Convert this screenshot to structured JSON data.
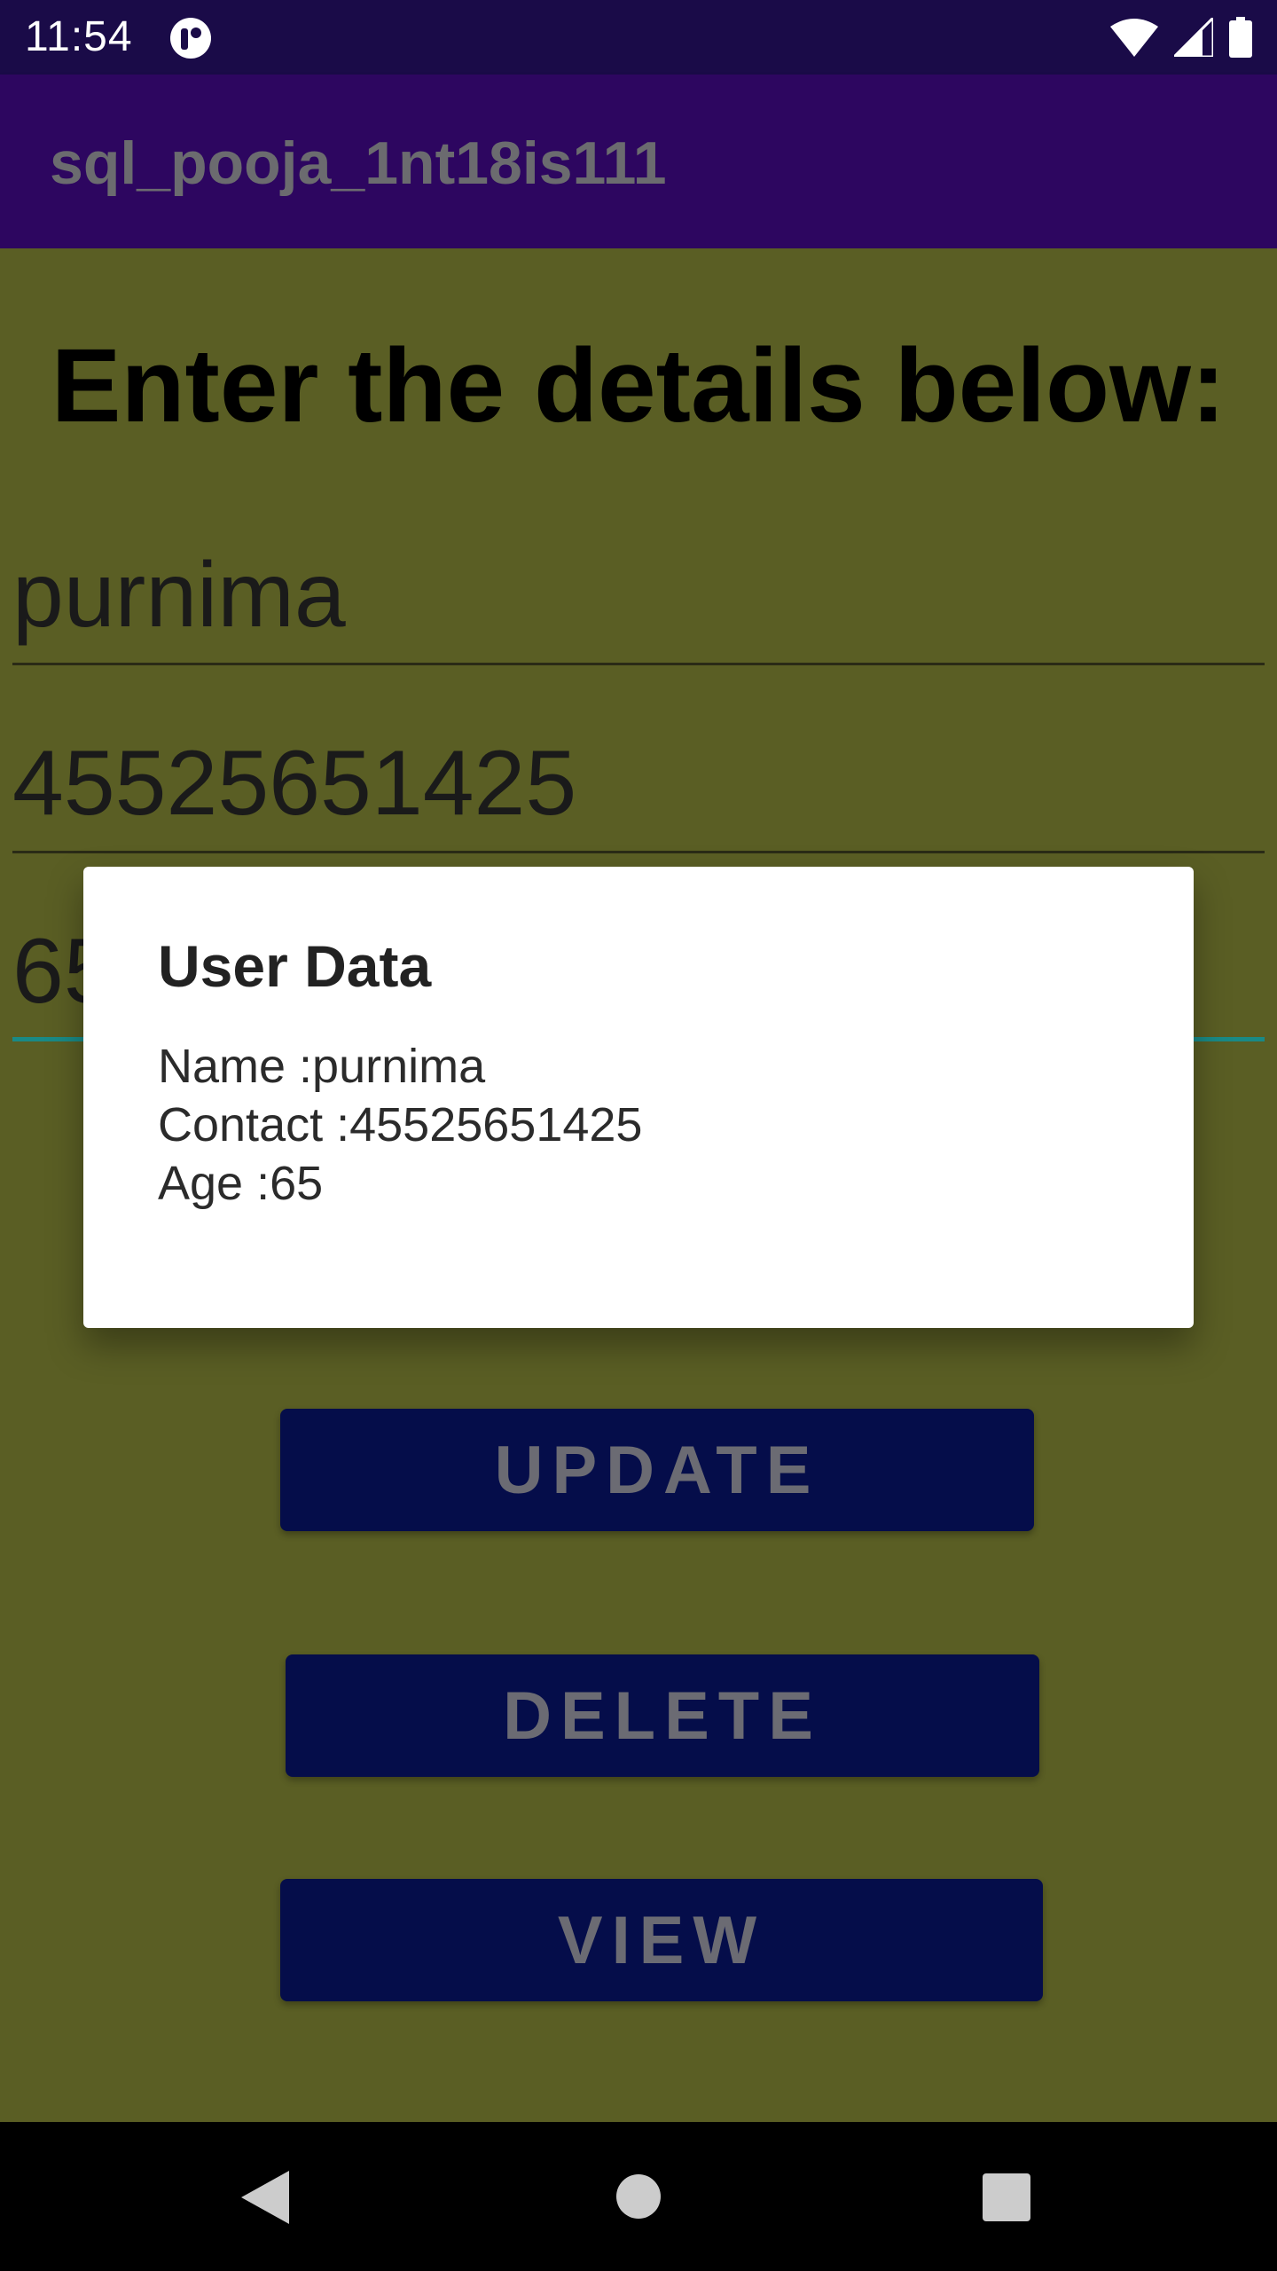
{
  "status_bar": {
    "time": "11:54",
    "icons": [
      "app-notification-icon",
      "wifi-icon",
      "signal-icon",
      "battery-icon"
    ]
  },
  "app_bar": {
    "title": "sql_pooja_1nt18is111"
  },
  "form": {
    "heading": "Enter the details below:",
    "name_value": "purnima",
    "contact_value": "45525651425",
    "age_value": "65"
  },
  "buttons": {
    "update": "UPDATE",
    "delete": "DELETE",
    "view": "VIEW"
  },
  "dialog": {
    "title": "User Data",
    "lines": [
      "Name :purnima",
      "Contact :45525651425",
      "Age :65"
    ]
  },
  "nav_bar": {
    "icons": [
      "back-icon",
      "home-icon",
      "recents-icon"
    ]
  },
  "colors": {
    "status_bar": "#1a0b48",
    "app_bar": "#2d0660",
    "background": "#5a5e24",
    "button": "#050d4a",
    "accent": "#1a8a86"
  }
}
